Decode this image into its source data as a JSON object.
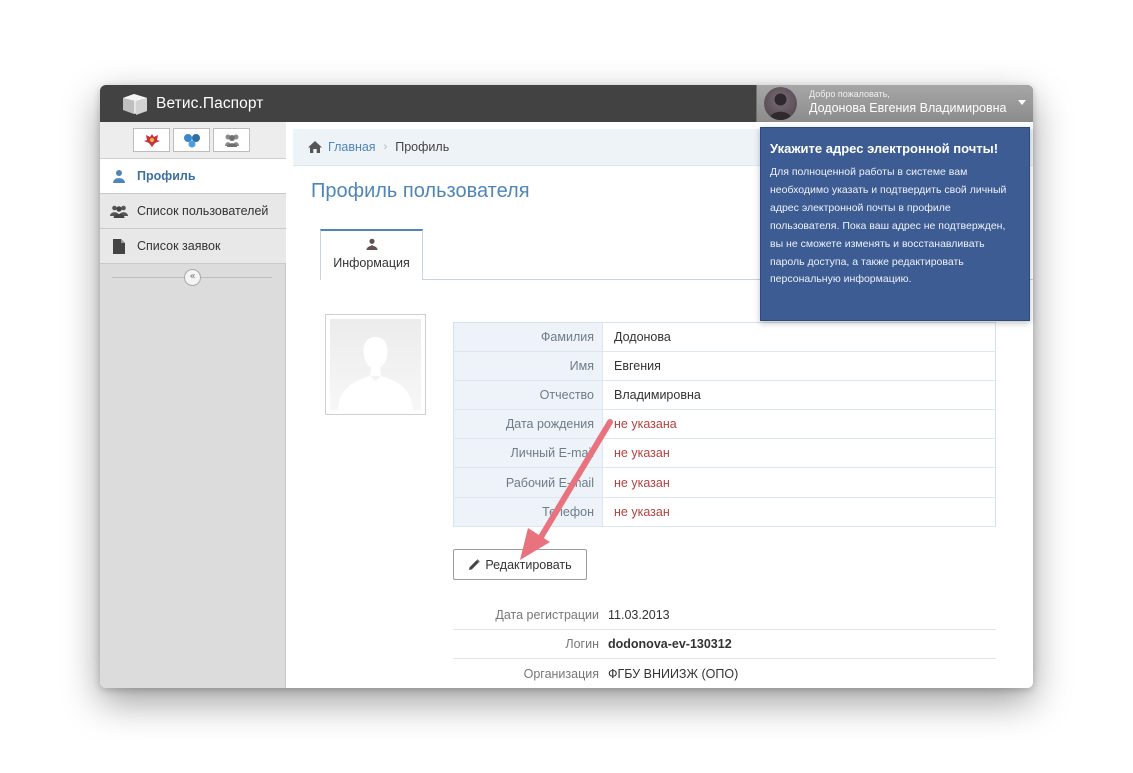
{
  "app": {
    "title": "Ветис.Паспорт"
  },
  "user": {
    "welcome": "Добро пожаловать,",
    "name": "Додонова Евгения Владимировна"
  },
  "sidebar": {
    "shortcuts": [
      {
        "icon": "coat-of-arms-icon"
      },
      {
        "icon": "molecules-icon"
      },
      {
        "icon": "users-group-icon"
      }
    ],
    "items": [
      {
        "label": "Профиль",
        "icon": "user-icon",
        "active": true
      },
      {
        "label": "Список пользователей",
        "icon": "users-icon",
        "active": false
      },
      {
        "label": "Список заявок",
        "icon": "document-icon",
        "active": false
      }
    ],
    "collapse_label": "«"
  },
  "breadcrumb": {
    "home": "Главная",
    "separator": "›",
    "current": "Профиль"
  },
  "page": {
    "title": "Профиль пользователя"
  },
  "tabs": [
    {
      "label": "Информация",
      "icon": "user-icon",
      "active": true
    }
  ],
  "profile": {
    "fields": [
      {
        "label": "Фамилия",
        "value": "Додонова",
        "missing": false
      },
      {
        "label": "Имя",
        "value": "Евгения",
        "missing": false
      },
      {
        "label": "Отчество",
        "value": "Владимировна",
        "missing": false
      },
      {
        "label": "Дата рождения",
        "value": "не указана",
        "missing": true
      },
      {
        "label": "Личный E-mail",
        "value": "не указан",
        "missing": true
      },
      {
        "label": "Рабочий E-mail",
        "value": "не указан",
        "missing": true
      },
      {
        "label": "Телефон",
        "value": "не указан",
        "missing": true
      }
    ],
    "edit_label": "Редактировать",
    "meta": [
      {
        "label": "Дата регистрации",
        "value": "11.03.2013",
        "bold": false
      },
      {
        "label": "Логин",
        "value": "dodonova-ev-130312",
        "bold": true
      },
      {
        "label": "Организация",
        "value": "ФГБУ ВНИИЗЖ (ОПО)",
        "bold": false
      }
    ]
  },
  "notice": {
    "title": "Укажите адрес электронной почты!",
    "text": "Для полноценной работы в системе вам необходимо указать и подтвердить свой личный адрес электронной почты в профиле пользователя. Пока ваш адрес не подтвержден, вы не сможете изменять и восстанавливать пароль доступа, а также редактировать персональную информацию."
  },
  "colors": {
    "topbar": "#424242",
    "accent": "#4e86b8",
    "notice_bg": "#3d5c93",
    "missing_value": "#b84040",
    "arrow": "#e8737f"
  }
}
